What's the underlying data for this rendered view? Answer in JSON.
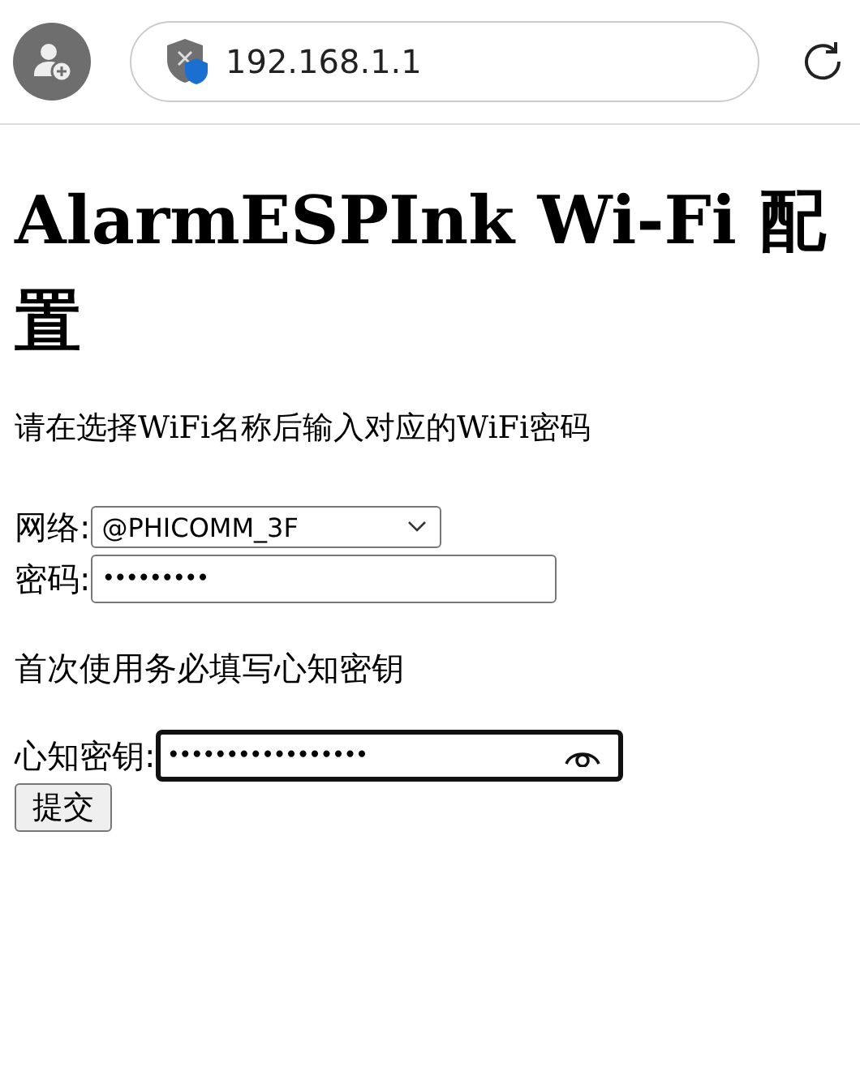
{
  "browser": {
    "url": "192.168.1.1"
  },
  "page": {
    "title": "AlarmESPInk Wi-Fi 配置",
    "intro": "请在选择WiFi名称后输入对应的WiFi密码",
    "network": {
      "label": "网络:",
      "value": "@PHICOMM_3F"
    },
    "password": {
      "label": "密码:",
      "value": "•••••••••"
    },
    "note": "首次使用务必填写心知密钥",
    "key": {
      "label": "心知密钥:",
      "value": "•••••••••••••••••",
      "focused": true
    },
    "submit": "提交"
  }
}
